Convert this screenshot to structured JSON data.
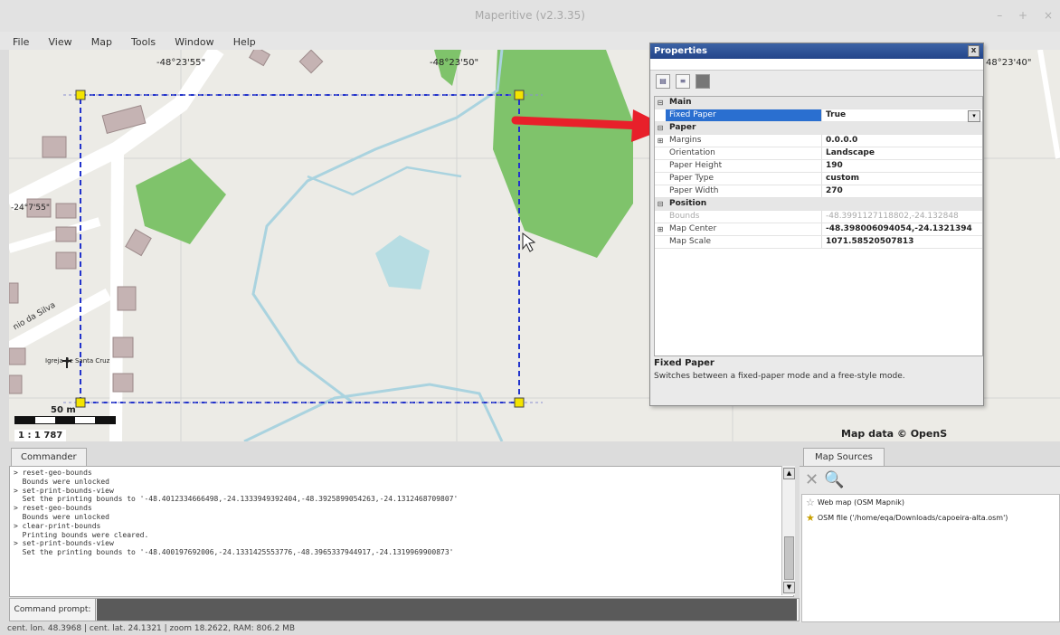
{
  "app": {
    "title": "Maperitive (v2.3.35)",
    "controls": [
      "–",
      "+",
      "×"
    ]
  },
  "menu": [
    "File",
    "View",
    "Map",
    "Tools",
    "Window",
    "Help"
  ],
  "map": {
    "coords_top": [
      "-48°23'55\"",
      "-48°23'50\"",
      "48°23'40\""
    ],
    "coord_left": "-24°7'55\"",
    "street": "nio da Silva",
    "church": "Igreja de Santa Cruz",
    "scale_label": "50 m",
    "scale_ratio": "1 : 1 787",
    "credit": "Map data © OpenS"
  },
  "properties": {
    "title": "Properties",
    "close": "x",
    "rows": [
      {
        "type": "cat",
        "key": "Main"
      },
      {
        "type": "sel",
        "key": "Fixed Paper",
        "value": "True"
      },
      {
        "type": "cat",
        "key": "Paper"
      },
      {
        "type": "exp",
        "key": "Margins",
        "value": "0.0.0.0"
      },
      {
        "type": "row",
        "key": "Orientation",
        "value": "Landscape"
      },
      {
        "type": "row",
        "key": "Paper Height",
        "value": "190"
      },
      {
        "type": "row",
        "key": "Paper Type",
        "value": "custom"
      },
      {
        "type": "row",
        "key": "Paper Width",
        "value": "270"
      },
      {
        "type": "cat",
        "key": "Position"
      },
      {
        "type": "dis",
        "key": "Bounds",
        "value": "-48.3991127118802,-24.132848"
      },
      {
        "type": "exp",
        "key": "Map Center",
        "value": "-48.398006094054,-24.1321394"
      },
      {
        "type": "row",
        "key": "Map Scale",
        "value": "1071.58520507813"
      }
    ],
    "desc_title": "Fixed Paper",
    "desc_text": "Switches between a fixed-paper mode and a free-style mode."
  },
  "commander": {
    "tab": "Commander",
    "log": [
      "> reset-geo-bounds",
      "  Bounds were unlocked",
      "> set-print-bounds-view",
      "  Set the printing bounds to '-48.4012334666498,-24.1333949392404,-48.3925899054263,-24.1312468709807'",
      "> reset-geo-bounds",
      "  Bounds were unlocked",
      "> clear-print-bounds",
      "  Printing bounds were cleared.",
      "> set-print-bounds-view",
      "  Set the printing bounds to '-48.400197692006,-24.1331425553776,-48.3965337944917,-24.1319969900873'"
    ],
    "prompt_label": "Command prompt:",
    "prompt_value": ""
  },
  "sources": {
    "tab": "Map Sources",
    "items": [
      {
        "icon": "web-map-icon",
        "label": "Web map (OSM Mapnik)"
      },
      {
        "icon": "osm-file-icon",
        "label": "OSM file ('/home/eqa/Downloads/capoeira-alta.osm')"
      }
    ]
  },
  "status": "cent. lon. 48.3968 | cent. lat. 24.1321 | zoom 18.2622, RAM: 806.2 MB",
  "colors": {
    "accent": "#2a6fd0",
    "arrow": "#e8202a",
    "bounds": "#2233cc",
    "forest": "#7fc36b",
    "water": "#b7dde3"
  }
}
